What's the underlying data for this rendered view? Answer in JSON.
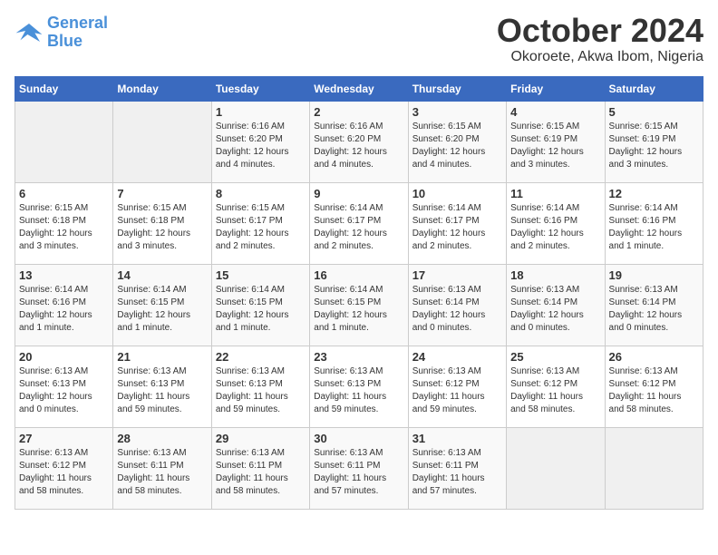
{
  "header": {
    "logo_line1": "General",
    "logo_line2": "Blue",
    "month": "October 2024",
    "location": "Okoroete, Akwa Ibom, Nigeria"
  },
  "days_of_week": [
    "Sunday",
    "Monday",
    "Tuesday",
    "Wednesday",
    "Thursday",
    "Friday",
    "Saturday"
  ],
  "weeks": [
    [
      {
        "day": "",
        "info": ""
      },
      {
        "day": "",
        "info": ""
      },
      {
        "day": "1",
        "info": "Sunrise: 6:16 AM\nSunset: 6:20 PM\nDaylight: 12 hours\nand 4 minutes."
      },
      {
        "day": "2",
        "info": "Sunrise: 6:16 AM\nSunset: 6:20 PM\nDaylight: 12 hours\nand 4 minutes."
      },
      {
        "day": "3",
        "info": "Sunrise: 6:15 AM\nSunset: 6:20 PM\nDaylight: 12 hours\nand 4 minutes."
      },
      {
        "day": "4",
        "info": "Sunrise: 6:15 AM\nSunset: 6:19 PM\nDaylight: 12 hours\nand 3 minutes."
      },
      {
        "day": "5",
        "info": "Sunrise: 6:15 AM\nSunset: 6:19 PM\nDaylight: 12 hours\nand 3 minutes."
      }
    ],
    [
      {
        "day": "6",
        "info": "Sunrise: 6:15 AM\nSunset: 6:18 PM\nDaylight: 12 hours\nand 3 minutes."
      },
      {
        "day": "7",
        "info": "Sunrise: 6:15 AM\nSunset: 6:18 PM\nDaylight: 12 hours\nand 3 minutes."
      },
      {
        "day": "8",
        "info": "Sunrise: 6:15 AM\nSunset: 6:17 PM\nDaylight: 12 hours\nand 2 minutes."
      },
      {
        "day": "9",
        "info": "Sunrise: 6:14 AM\nSunset: 6:17 PM\nDaylight: 12 hours\nand 2 minutes."
      },
      {
        "day": "10",
        "info": "Sunrise: 6:14 AM\nSunset: 6:17 PM\nDaylight: 12 hours\nand 2 minutes."
      },
      {
        "day": "11",
        "info": "Sunrise: 6:14 AM\nSunset: 6:16 PM\nDaylight: 12 hours\nand 2 minutes."
      },
      {
        "day": "12",
        "info": "Sunrise: 6:14 AM\nSunset: 6:16 PM\nDaylight: 12 hours\nand 1 minute."
      }
    ],
    [
      {
        "day": "13",
        "info": "Sunrise: 6:14 AM\nSunset: 6:16 PM\nDaylight: 12 hours\nand 1 minute."
      },
      {
        "day": "14",
        "info": "Sunrise: 6:14 AM\nSunset: 6:15 PM\nDaylight: 12 hours\nand 1 minute."
      },
      {
        "day": "15",
        "info": "Sunrise: 6:14 AM\nSunset: 6:15 PM\nDaylight: 12 hours\nand 1 minute."
      },
      {
        "day": "16",
        "info": "Sunrise: 6:14 AM\nSunset: 6:15 PM\nDaylight: 12 hours\nand 1 minute."
      },
      {
        "day": "17",
        "info": "Sunrise: 6:13 AM\nSunset: 6:14 PM\nDaylight: 12 hours\nand 0 minutes."
      },
      {
        "day": "18",
        "info": "Sunrise: 6:13 AM\nSunset: 6:14 PM\nDaylight: 12 hours\nand 0 minutes."
      },
      {
        "day": "19",
        "info": "Sunrise: 6:13 AM\nSunset: 6:14 PM\nDaylight: 12 hours\nand 0 minutes."
      }
    ],
    [
      {
        "day": "20",
        "info": "Sunrise: 6:13 AM\nSunset: 6:13 PM\nDaylight: 12 hours\nand 0 minutes."
      },
      {
        "day": "21",
        "info": "Sunrise: 6:13 AM\nSunset: 6:13 PM\nDaylight: 11 hours\nand 59 minutes."
      },
      {
        "day": "22",
        "info": "Sunrise: 6:13 AM\nSunset: 6:13 PM\nDaylight: 11 hours\nand 59 minutes."
      },
      {
        "day": "23",
        "info": "Sunrise: 6:13 AM\nSunset: 6:13 PM\nDaylight: 11 hours\nand 59 minutes."
      },
      {
        "day": "24",
        "info": "Sunrise: 6:13 AM\nSunset: 6:12 PM\nDaylight: 11 hours\nand 59 minutes."
      },
      {
        "day": "25",
        "info": "Sunrise: 6:13 AM\nSunset: 6:12 PM\nDaylight: 11 hours\nand 58 minutes."
      },
      {
        "day": "26",
        "info": "Sunrise: 6:13 AM\nSunset: 6:12 PM\nDaylight: 11 hours\nand 58 minutes."
      }
    ],
    [
      {
        "day": "27",
        "info": "Sunrise: 6:13 AM\nSunset: 6:12 PM\nDaylight: 11 hours\nand 58 minutes."
      },
      {
        "day": "28",
        "info": "Sunrise: 6:13 AM\nSunset: 6:11 PM\nDaylight: 11 hours\nand 58 minutes."
      },
      {
        "day": "29",
        "info": "Sunrise: 6:13 AM\nSunset: 6:11 PM\nDaylight: 11 hours\nand 58 minutes."
      },
      {
        "day": "30",
        "info": "Sunrise: 6:13 AM\nSunset: 6:11 PM\nDaylight: 11 hours\nand 57 minutes."
      },
      {
        "day": "31",
        "info": "Sunrise: 6:13 AM\nSunset: 6:11 PM\nDaylight: 11 hours\nand 57 minutes."
      },
      {
        "day": "",
        "info": ""
      },
      {
        "day": "",
        "info": ""
      }
    ]
  ]
}
